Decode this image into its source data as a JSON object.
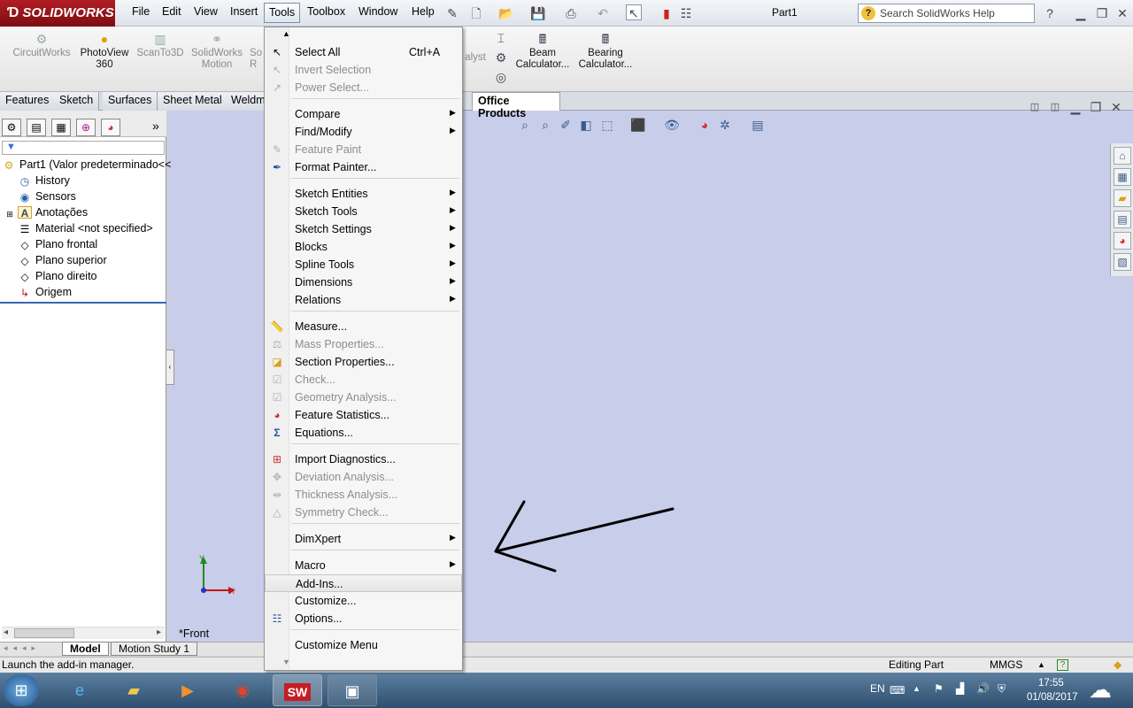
{
  "app": {
    "brand": "SOLIDWORKS",
    "doc_title": "Part1"
  },
  "menubar": [
    "File",
    "Edit",
    "View",
    "Insert",
    "Tools",
    "Toolbox",
    "Window",
    "Help"
  ],
  "search": {
    "placeholder": "Search SolidWorks Help"
  },
  "command_buttons": [
    {
      "l1": "CircuitWorks",
      "l2": ""
    },
    {
      "l1": "PhotoView",
      "l2": "360"
    },
    {
      "l1": "ScanTo3D",
      "l2": ""
    },
    {
      "l1": "SolidWorks",
      "l2": "Motion"
    },
    {
      "l1": "So",
      "l2": "R"
    }
  ],
  "command_buttons_right": [
    {
      "l1": "Beam",
      "l2": "Calculator..."
    },
    {
      "l1": "Bearing",
      "l2": "Calculator..."
    }
  ],
  "partial_alyst": "alyst",
  "tabs": [
    "Features",
    "Sketch",
    "Surfaces",
    "Sheet Metal",
    "Weldm",
    "Office Products"
  ],
  "feature_tree": [
    {
      "icon": "part",
      "label": "Part1  (Valor predeterminado<<"
    },
    {
      "icon": "history",
      "label": "History"
    },
    {
      "icon": "sensor",
      "label": "Sensors"
    },
    {
      "icon": "annotation",
      "label": "Anotações"
    },
    {
      "icon": "material",
      "label": "Material <not specified>"
    },
    {
      "icon": "plane",
      "label": "Plano frontal"
    },
    {
      "icon": "plane",
      "label": "Plano superior"
    },
    {
      "icon": "plane",
      "label": "Plano direito"
    },
    {
      "icon": "origin",
      "label": "Origem"
    }
  ],
  "tools_menu": [
    {
      "label": "Select All",
      "shortcut": "Ctrl+A",
      "enabled": true
    },
    {
      "label": "Invert Selection",
      "enabled": false
    },
    {
      "label": "Power Select...",
      "enabled": false
    },
    {
      "label": "Compare",
      "enabled": true,
      "submenu": true
    },
    {
      "label": "Find/Modify",
      "enabled": true,
      "submenu": true
    },
    {
      "label": "Feature Paint",
      "enabled": false
    },
    {
      "label": "Format Painter...",
      "enabled": true
    },
    {
      "label": "Sketch Entities",
      "enabled": true,
      "submenu": true
    },
    {
      "label": "Sketch Tools",
      "enabled": true,
      "submenu": true
    },
    {
      "label": "Sketch Settings",
      "enabled": true,
      "submenu": true
    },
    {
      "label": "Blocks",
      "enabled": true,
      "submenu": true
    },
    {
      "label": "Spline Tools",
      "enabled": true,
      "submenu": true
    },
    {
      "label": "Dimensions",
      "enabled": true,
      "submenu": true
    },
    {
      "label": "Relations",
      "enabled": true,
      "submenu": true
    },
    {
      "label": "Measure...",
      "enabled": true
    },
    {
      "label": "Mass Properties...",
      "enabled": false
    },
    {
      "label": "Section Properties...",
      "enabled": true
    },
    {
      "label": "Check...",
      "enabled": false
    },
    {
      "label": "Geometry Analysis...",
      "enabled": false
    },
    {
      "label": "Feature Statistics...",
      "enabled": true
    },
    {
      "label": "Equations...",
      "enabled": true
    },
    {
      "label": "Import Diagnostics...",
      "enabled": true
    },
    {
      "label": "Deviation  Analysis...",
      "enabled": false
    },
    {
      "label": "Thickness Analysis...",
      "enabled": false
    },
    {
      "label": "Symmetry Check...",
      "enabled": false
    },
    {
      "label": "DimXpert",
      "enabled": true,
      "submenu": true
    },
    {
      "label": "Macro",
      "enabled": true,
      "submenu": true
    },
    {
      "label": "Add-Ins...",
      "enabled": true,
      "highlighted": true
    },
    {
      "label": "Customize...",
      "enabled": true
    },
    {
      "label": "Options...",
      "enabled": true
    },
    {
      "label": "Customize Menu",
      "enabled": true
    }
  ],
  "viewport": {
    "view_label": "*Front",
    "axis_y": "Y",
    "axis_x": "X"
  },
  "model_tabs": [
    "Model",
    "Motion Study 1"
  ],
  "status": {
    "left": "Launch the add-in manager.",
    "mode": "Editing Part",
    "units": "MMGS"
  },
  "taskbar": {
    "lang": "EN",
    "time": "17:55",
    "date": "01/08/2017"
  },
  "colors": {
    "brand": "#b11d24",
    "viewport": "#c8cdea",
    "taskbar": "#2e4f6e"
  }
}
